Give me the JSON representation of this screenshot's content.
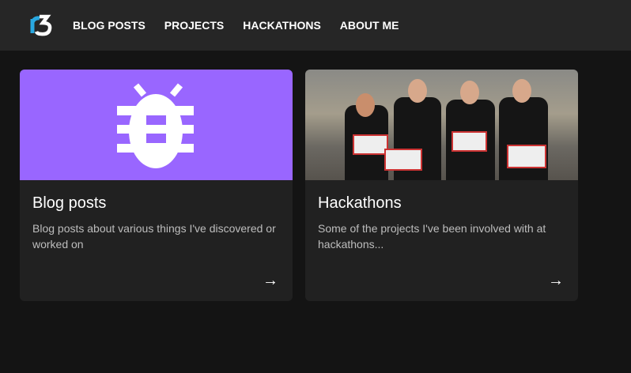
{
  "nav": {
    "logo": "r3",
    "links": [
      "BLOG POSTS",
      "PROJECTS",
      "HACKATHONS",
      "ABOUT ME"
    ]
  },
  "cards": [
    {
      "title": "Blog posts",
      "description": "Blog posts about various things I've discovered or worked on",
      "icon": "bug-icon",
      "color": "#9966ff"
    },
    {
      "title": "Hackathons",
      "description": "Some of the projects I've been involved with at hackathons...",
      "icon": "arrow-right-icon"
    }
  ]
}
